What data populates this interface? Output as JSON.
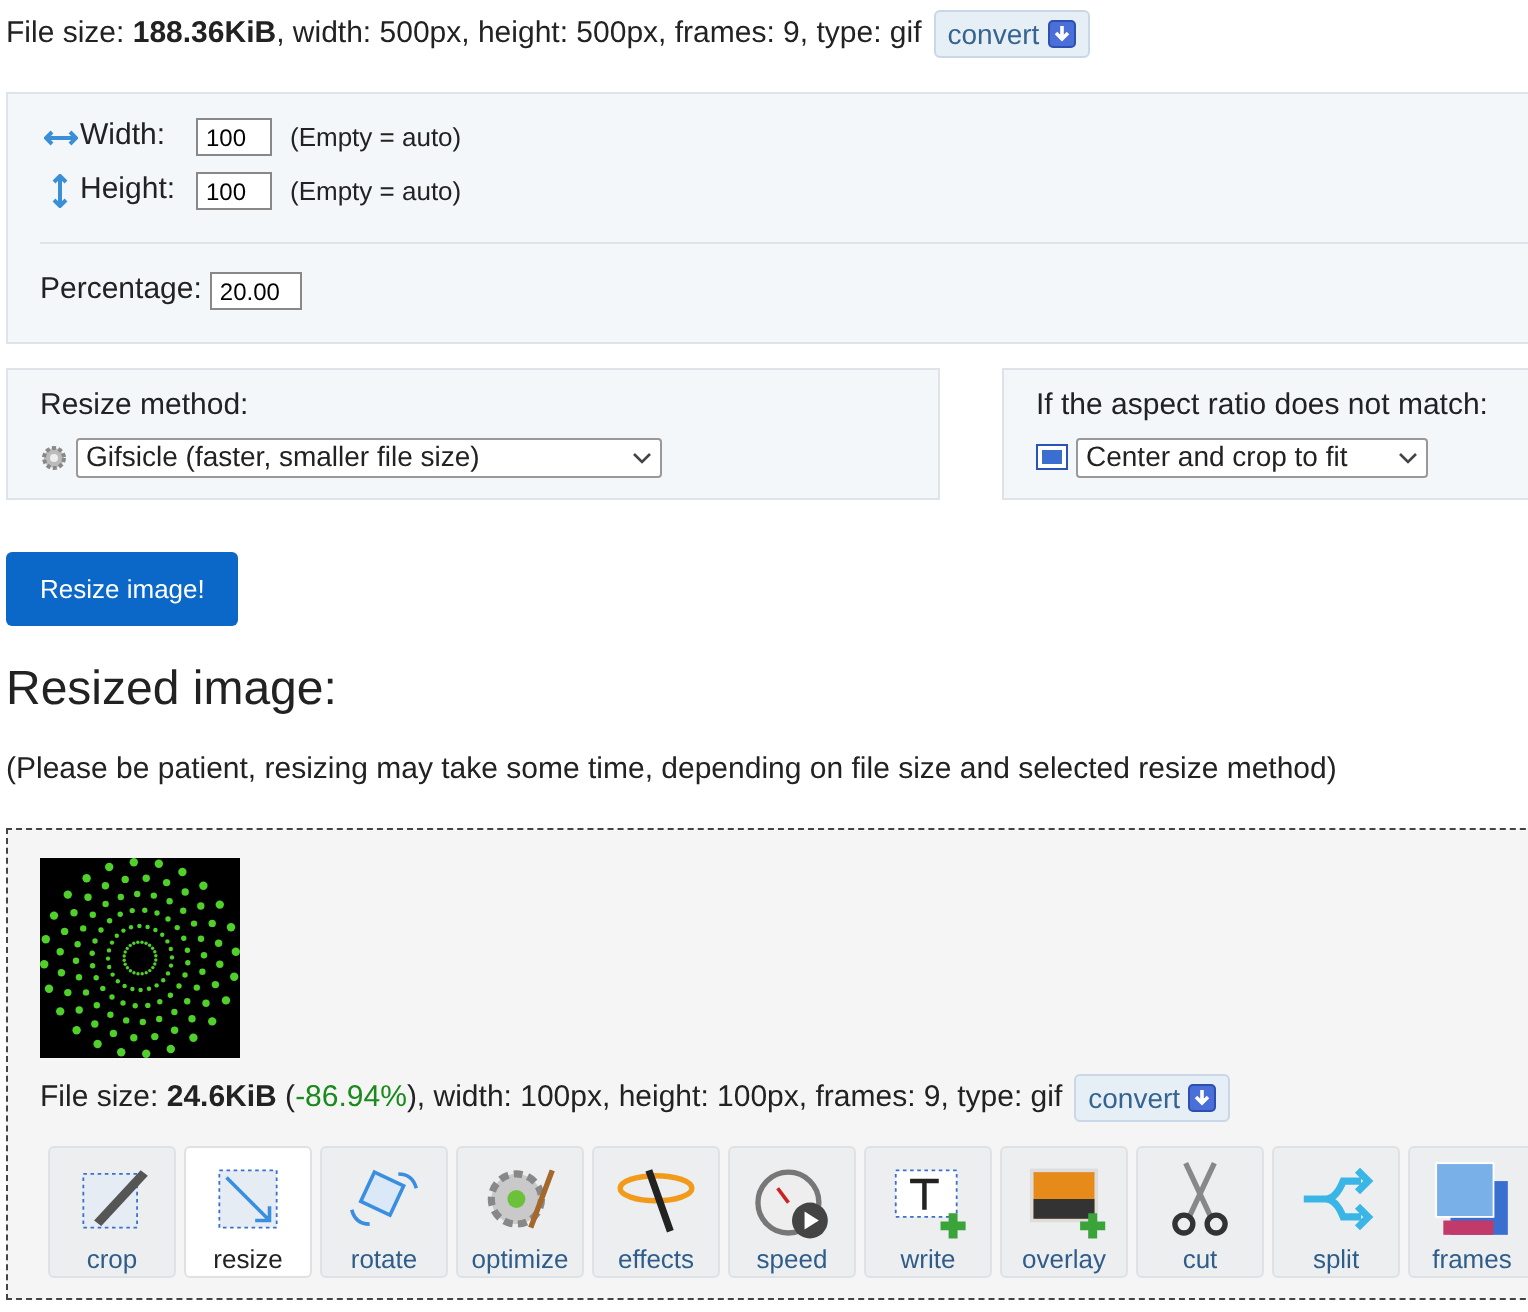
{
  "source_info": {
    "text": "File size: **188.36KiB**, width: 500px, height: 500px, frames: 9, type: gif",
    "convert_label": "convert"
  },
  "size_panel": {
    "width": {
      "label": "Width:",
      "value": "100",
      "hint": "(Empty = auto)"
    },
    "height": {
      "label": "Height:",
      "value": "100",
      "hint": "(Empty = auto)"
    },
    "percentage": {
      "label": "Percentage:",
      "value": "20.00"
    }
  },
  "resize_method": {
    "label": "Resize method:",
    "value": "Gifsicle (faster, smaller file size)"
  },
  "aspect": {
    "label": "If the aspect ratio does not match:",
    "value": "Center and crop to fit"
  },
  "submit_label": "Resize image!",
  "result": {
    "heading": "Resized image:",
    "note": "(Please be patient, resizing may take some time, depending on file size and selected resize method)",
    "info_before": "File size: **24.6KiB** (",
    "change": "-86.94%",
    "info_after": "), width: 100px, height: 100px, frames: 9, type: gif",
    "convert_label": "convert"
  },
  "tools": [
    {
      "label": "crop",
      "selected": false
    },
    {
      "label": "resize",
      "selected": true
    },
    {
      "label": "rotate",
      "selected": false
    },
    {
      "label": "optimize",
      "selected": false
    },
    {
      "label": "effects",
      "selected": false
    },
    {
      "label": "speed",
      "selected": false
    },
    {
      "label": "write",
      "selected": false
    },
    {
      "label": "overlay",
      "selected": false
    },
    {
      "label": "cut",
      "selected": false
    },
    {
      "label": "split",
      "selected": false
    },
    {
      "label": "frames",
      "selected": false
    }
  ]
}
